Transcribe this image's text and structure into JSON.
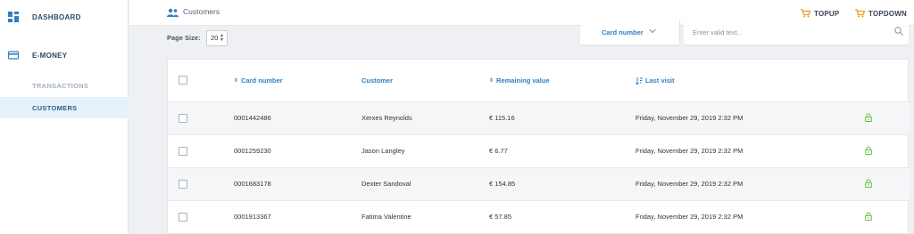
{
  "sidebar": {
    "dashboard_label": "DASHBOARD",
    "emoney_label": "E-MONEY",
    "transactions_label": "TRANSACTIONS",
    "customers_label": "CUSTOMERS"
  },
  "topbar": {
    "breadcrumb": "Customers",
    "topup_label": "TOPUP",
    "topdown_label": "TOPDOWN"
  },
  "pagination": {
    "label": "Page Size:",
    "selected": "20"
  },
  "filter": {
    "field_label": "Card number",
    "search_placeholder": "Enter valid text..."
  },
  "table": {
    "headers": {
      "card_number": "Card number",
      "customer": "Customer",
      "remaining_value": "Remaining value",
      "last_visit": "Last visit"
    },
    "rows": [
      {
        "card_number": "0001442486",
        "customer": "Xerxes Reynolds",
        "remaining_value": "€ 115.16",
        "last_visit": "Friday, November 29, 2019 2:32 PM"
      },
      {
        "card_number": "0001259230",
        "customer": "Jason Langley",
        "remaining_value": "€ 6.77",
        "last_visit": "Friday, November 29, 2019 2:32 PM"
      },
      {
        "card_number": "0001683178",
        "customer": "Dexter Sandoval",
        "remaining_value": "€ 154.85",
        "last_visit": "Friday, November 29, 2019 2:32 PM"
      },
      {
        "card_number": "0001913367",
        "customer": "Fatima Valentine",
        "remaining_value": "€ 57.85",
        "last_visit": "Friday, November 29, 2019 2:32 PM"
      }
    ]
  },
  "colors": {
    "accent": "#2f7fc1",
    "topup_icon": "#f29b1d",
    "lock_icon": "#6bbf4e"
  },
  "icons": {
    "dashboard": "grid-icon",
    "emoney": "card-icon",
    "breadcrumb": "users-icon",
    "topup": "cart-icon",
    "search": "search-icon",
    "row_status": "lock-icon"
  }
}
